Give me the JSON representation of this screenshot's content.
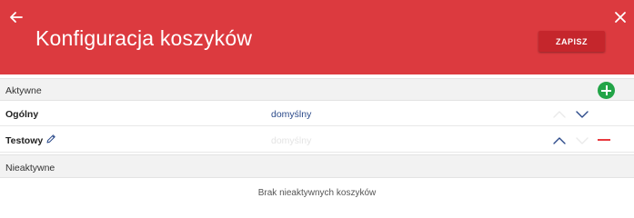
{
  "header": {
    "title": "Konfiguracja koszyków",
    "save_label": "ZAPISZ",
    "back_icon": "arrow-left-icon",
    "close_icon": "close-icon"
  },
  "active_section": {
    "label": "Aktywne",
    "add_icon": "plus-circle-icon",
    "rows": [
      {
        "name": "Ogólny",
        "mode": "domyślny",
        "editable": false,
        "can_move_up": false,
        "can_move_down": true,
        "can_remove": false
      },
      {
        "name": "Testowy",
        "mode": "domyślny",
        "editable": true,
        "can_move_up": true,
        "can_move_down": false,
        "can_remove": true
      }
    ]
  },
  "inactive_section": {
    "label": "Nieaktywne",
    "empty_message": "Brak nieaktywnych koszyków"
  },
  "colors": {
    "header_bg": "#dc3a3f",
    "save_button_bg": "#c5262c",
    "add_button": "#22a447",
    "remove_button": "#e83a3f",
    "link_blue": "#2b4a8a",
    "disabled": "#e4e4e4"
  }
}
